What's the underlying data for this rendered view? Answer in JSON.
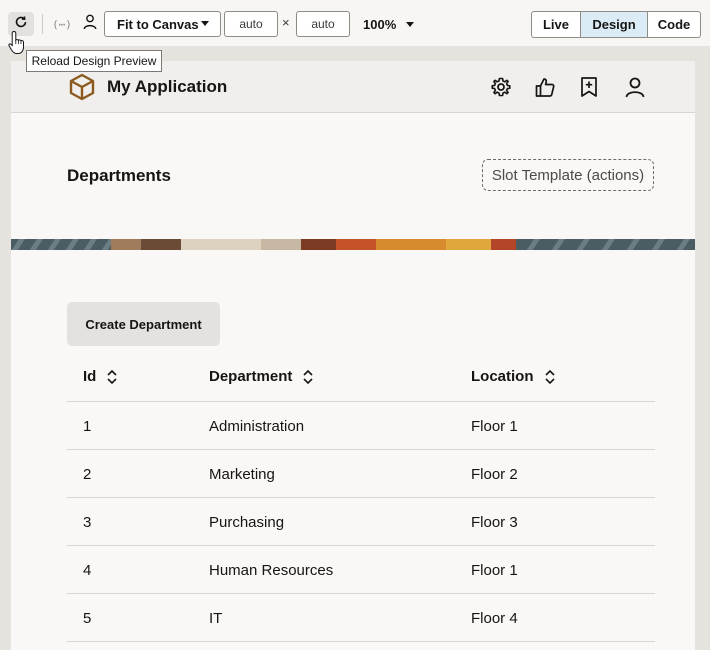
{
  "toolbar": {
    "reload_tooltip": "Reload Design Preview",
    "slot_glyph": "(⋯)",
    "fit_select": "Fit to Canvas",
    "width_value": "auto",
    "height_value": "auto",
    "times_symbol": "×",
    "zoom": "100%",
    "modes": [
      {
        "label": "Live",
        "active": false
      },
      {
        "label": "Design",
        "active": true
      },
      {
        "label": "Code",
        "active": false
      }
    ]
  },
  "app": {
    "title": "My Application",
    "header_icons": [
      "gear-icon",
      "thumbs-up-icon",
      "bookmark-add-icon",
      "user-icon"
    ]
  },
  "page": {
    "title": "Departments",
    "slot_template": "Slot Template (actions)",
    "create_button": "Create Department"
  },
  "table": {
    "columns": [
      "Id",
      "Department",
      "Location"
    ],
    "rows": [
      [
        "1",
        "Administration",
        "Floor 1"
      ],
      [
        "2",
        "Marketing",
        "Floor 2"
      ],
      [
        "3",
        "Purchasing",
        "Floor 3"
      ],
      [
        "4",
        "Human Resources",
        "Floor 1"
      ],
      [
        "5",
        "IT",
        "Floor 4"
      ]
    ]
  },
  "colors": {
    "active_mode_bg": "#dcecf6",
    "logo_brown": "#8b5a1e",
    "canvas_bg": "#f9f8f6"
  }
}
